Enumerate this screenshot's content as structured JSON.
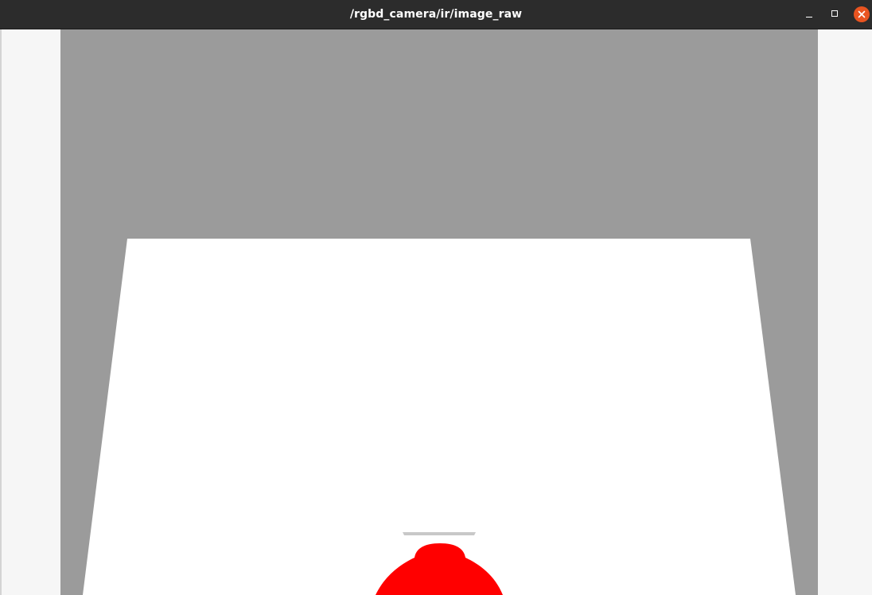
{
  "window": {
    "title": "/rgbd_camera/ir/image_raw",
    "controls": {
      "minimize_icon": "minimize-icon",
      "maximize_icon": "maximize-icon",
      "close_icon": "close-icon"
    }
  },
  "colors": {
    "titlebar": "#2c2c2c",
    "title_text": "#ffffff",
    "close_button": "#e95420",
    "background": "#f6f6f6",
    "image_sky": "#9b9b9b",
    "image_plane": "#ffffff",
    "image_object": "#ff0000",
    "image_rim": "#c8c8c8"
  }
}
